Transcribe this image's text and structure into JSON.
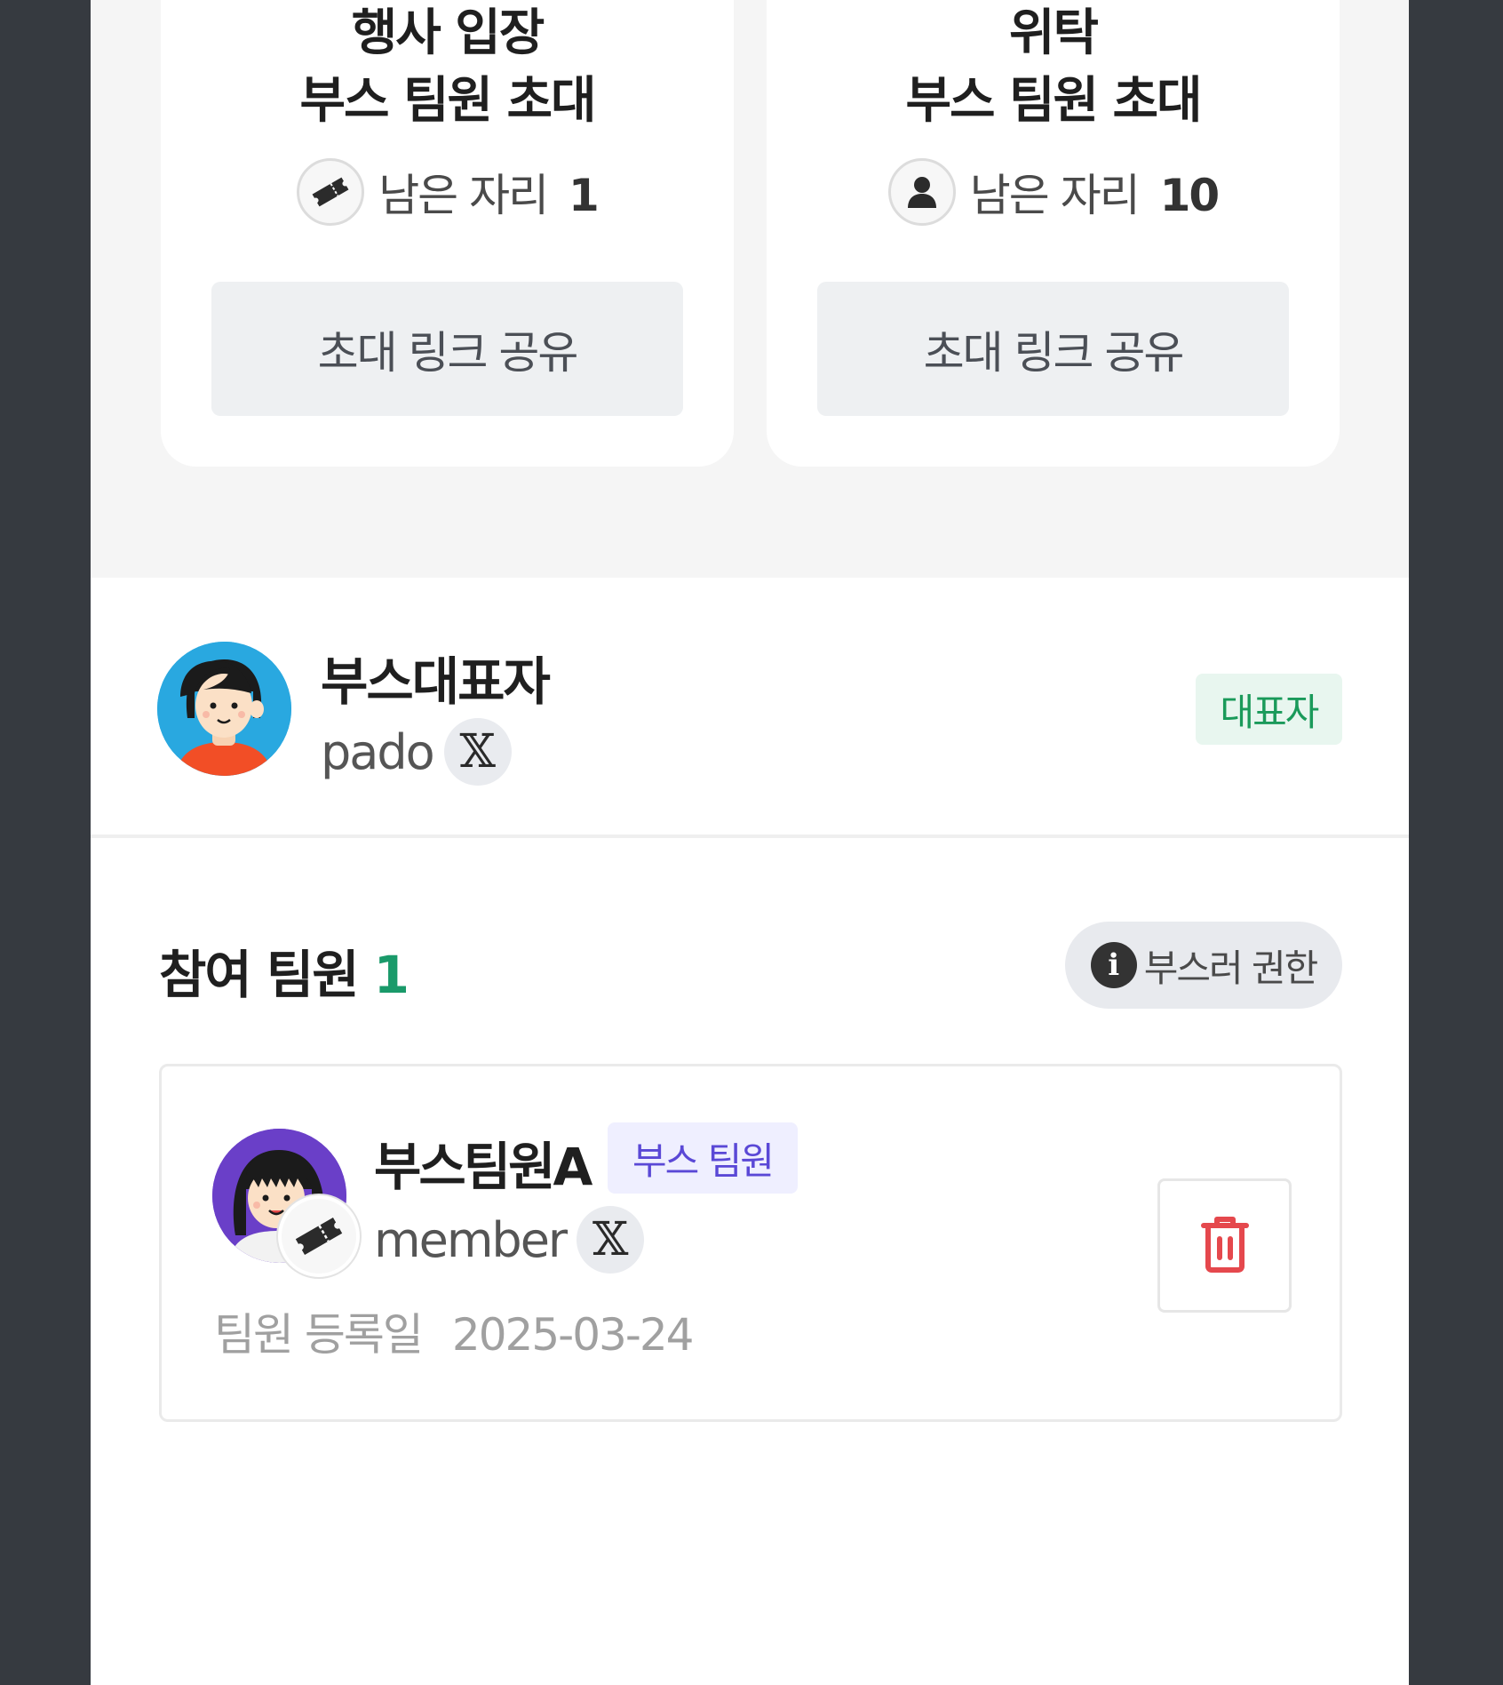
{
  "invite_cards": [
    {
      "title_line1": "행사 입장",
      "title_line2": "부스 팀원 초대",
      "seats_label": "남은 자리",
      "seats_count": "1",
      "icon": "ticket-icon",
      "share_label": "초대 링크 공유"
    },
    {
      "title_line1": "위탁",
      "title_line2": "부스 팀원 초대",
      "seats_label": "남은 자리",
      "seats_count": "10",
      "icon": "user-icon",
      "share_label": "초대 링크 공유"
    }
  ],
  "owner": {
    "name": "부스대표자",
    "handle": "pado",
    "social_icon": "x-logo-icon",
    "social_glyph": "𝕏",
    "badge": "대표자"
  },
  "members_section": {
    "title": "참여 팀원",
    "count": "1",
    "permission_button": "부스러 권한",
    "info_glyph": "i"
  },
  "members": [
    {
      "name": "부스팀원A",
      "role": "부스 팀원",
      "handle": "member",
      "social_glyph": "𝕏",
      "registered_label": "팀원 등록일",
      "registered_date": "2025-03-24"
    }
  ],
  "colors": {
    "backdrop": "#363a40",
    "accent_green": "#1a9a6a",
    "role_purple": "#5a48d6",
    "delete_red": "#e5484d"
  }
}
